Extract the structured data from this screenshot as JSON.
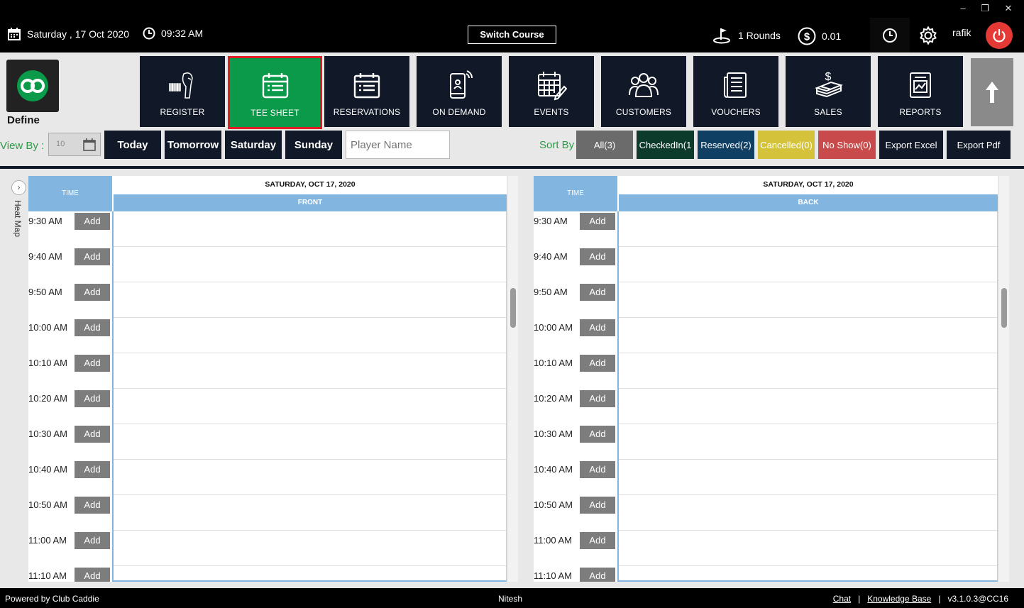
{
  "window": {
    "minimize": "–",
    "restore": "❐",
    "close": "✕"
  },
  "topbar": {
    "date": "Saturday ,  17 Oct 2020",
    "time": "09:32 AM",
    "switch_course": "Switch Course",
    "rounds": "1 Rounds",
    "balance": "0.01",
    "user": "rafik"
  },
  "logo": {
    "label": "Define"
  },
  "nav": [
    {
      "label": "REGISTER",
      "icon": "barcode-scanner-icon"
    },
    {
      "label": "TEE SHEET",
      "icon": "tee-sheet-icon",
      "active": true
    },
    {
      "label": "RESERVATIONS",
      "icon": "reservations-icon"
    },
    {
      "label": "ON DEMAND",
      "icon": "on-demand-phone-icon"
    },
    {
      "label": "EVENTS",
      "icon": "events-calendar-icon"
    },
    {
      "label": "CUSTOMERS",
      "icon": "customers-icon"
    },
    {
      "label": "VOUCHERS",
      "icon": "vouchers-icon"
    },
    {
      "label": "SALES",
      "icon": "sales-icon"
    },
    {
      "label": "REPORTS",
      "icon": "reports-icon"
    }
  ],
  "filters": {
    "view_by_label": "View By :",
    "view_by_value": "10",
    "days": [
      "Today",
      "Tomorrow",
      "Saturday",
      "Sunday"
    ],
    "player_placeholder": "Player Name",
    "sort_by_label": "Sort By",
    "sort": [
      {
        "label": "All(3)",
        "color": "#6b6b6b"
      },
      {
        "label": "CheckedIn(1",
        "color": "#0c3b2b"
      },
      {
        "label": "Reserved(2)",
        "color": "#0f3f63"
      },
      {
        "label": "Cancelled(0)",
        "color": "#d4c33a"
      },
      {
        "label": "No Show(0)",
        "color": "#c94a4a"
      }
    ],
    "export_excel": "Export Excel",
    "export_pdf": "Export Pdf"
  },
  "heatmap": {
    "label": "Heat Map"
  },
  "panels": [
    {
      "time_header": "TIME",
      "date": "SATURDAY, OCT 17, 2020",
      "side": "FRONT"
    },
    {
      "time_header": "TIME",
      "date": "SATURDAY, OCT 17, 2020",
      "side": "BACK"
    }
  ],
  "slots": [
    "9:30 AM",
    "9:40 AM",
    "9:50 AM",
    "10:00 AM",
    "10:10 AM",
    "10:20 AM",
    "10:30 AM",
    "10:40 AM",
    "10:50 AM",
    "11:00 AM",
    "11:10 AM"
  ],
  "add_label": "Add",
  "footer": {
    "powered_by": "Powered by Club Caddie",
    "center": "Nitesh",
    "chat": "Chat",
    "sep": "|",
    "knowledge_base": "Knowledge Base",
    "version": "v3.1.0.3@CC16"
  },
  "colors": {
    "active_nav": "#0a9a49",
    "nav_bg": "#111827",
    "header_blue": "#82b6e0",
    "power": "#e53935"
  }
}
